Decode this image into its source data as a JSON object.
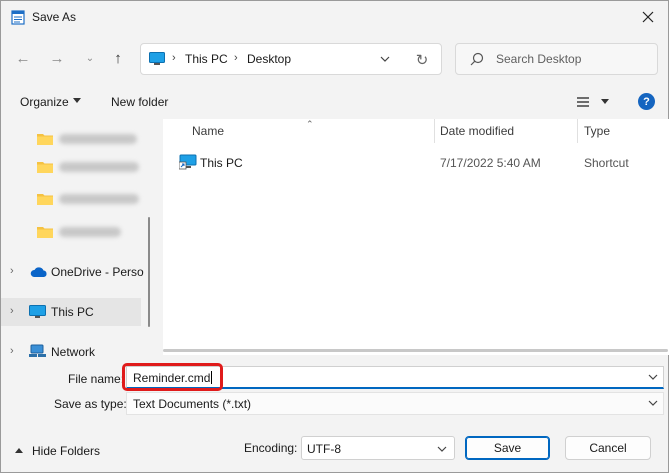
{
  "window": {
    "title": "Save As"
  },
  "navbar": {
    "breadcrumbs": [
      "This PC",
      "Desktop"
    ],
    "search_placeholder": "Search Desktop"
  },
  "toolbar": {
    "organize_label": "Organize",
    "new_folder_label": "New folder",
    "help_label": "?"
  },
  "nav_pane": {
    "items": [
      {
        "label": "OneDrive - Perso"
      },
      {
        "label": "This PC"
      },
      {
        "label": "Network"
      }
    ]
  },
  "file_list": {
    "columns": [
      "Name",
      "Date modified",
      "Type"
    ],
    "rows": [
      {
        "name": "This PC",
        "date_modified": "7/17/2022 5:40 AM",
        "type": "Shortcut"
      }
    ]
  },
  "form": {
    "file_name_label": "File name:",
    "file_name_value": "Reminder.cmd",
    "save_as_type_label": "Save as type:",
    "save_as_type_value": "Text Documents (*.txt)",
    "encoding_label": "Encoding:",
    "encoding_value": "UTF-8"
  },
  "footer": {
    "hide_folders_label": "Hide Folders",
    "save_label": "Save",
    "cancel_label": "Cancel"
  },
  "colors": {
    "accent": "#0067c0",
    "highlight": "#e01b1b",
    "folder": "#f5c242"
  }
}
